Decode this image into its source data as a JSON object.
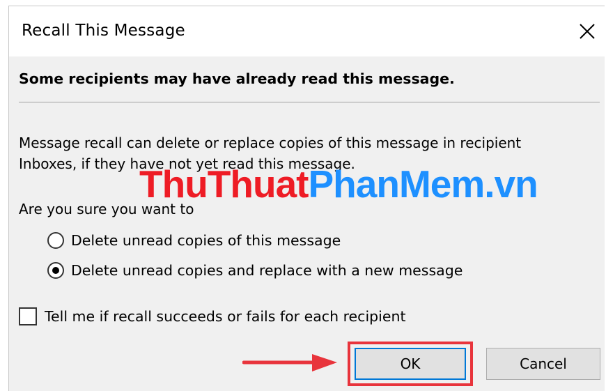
{
  "window": {
    "title": "Recall This Message"
  },
  "warning": "Some recipients may have already read this message.",
  "description": {
    "line1": "Message recall can delete or replace copies of this message in recipient",
    "line2": "Inboxes, if they have not yet read this message."
  },
  "watermark": {
    "part_red": "ThuThuat",
    "part_blue": "PhanMem.vn"
  },
  "question": "Are you sure you want to",
  "options": [
    {
      "label": "Delete unread copies of this message",
      "selected": false
    },
    {
      "label": "Delete unread copies and replace with a new message",
      "selected": true
    }
  ],
  "checkbox": {
    "label": "Tell me if recall succeeds or fails for each recipient",
    "checked": false
  },
  "buttons": {
    "ok": "OK",
    "cancel": "Cancel"
  },
  "colors": {
    "highlight": "#e8343c",
    "focus_border": "#0078d7",
    "watermark_red": "#ee1c25",
    "watermark_blue": "#1e90ff"
  }
}
